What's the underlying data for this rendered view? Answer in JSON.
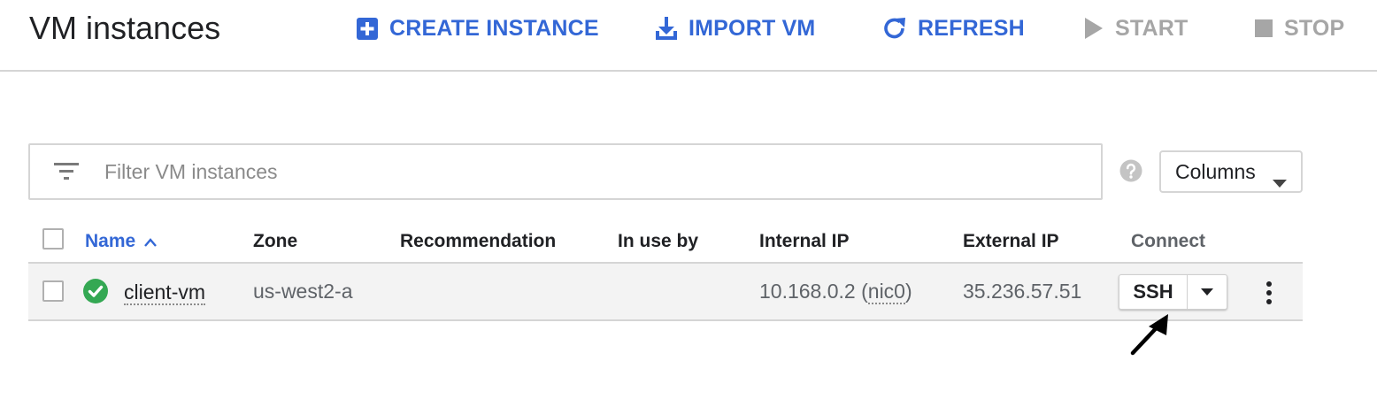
{
  "header": {
    "title": "VM instances",
    "actions": {
      "create": "CREATE INSTANCE",
      "import": "IMPORT VM",
      "refresh": "REFRESH",
      "start": "START",
      "stop": "STOP"
    }
  },
  "filter": {
    "placeholder": "Filter VM instances"
  },
  "columns_button": {
    "label": "Columns"
  },
  "table": {
    "headers": {
      "name": "Name",
      "zone": "Zone",
      "recommendation": "Recommendation",
      "in_use_by": "In use by",
      "internal_ip": "Internal IP",
      "external_ip": "External IP",
      "connect": "Connect"
    },
    "rows": [
      {
        "name": "client-vm",
        "zone": "us-west2-a",
        "recommendation": "",
        "in_use_by": "",
        "internal_ip_address": "10.168.0.2",
        "internal_ip_nic": "nic0",
        "external_ip": "35.236.57.51",
        "connect_label": "SSH",
        "status": "running"
      }
    ]
  },
  "colors": {
    "accent": "#3367d6",
    "disabled": "#a6a6a6",
    "status_ok": "#34a853",
    "row_bg": "#f3f3f3",
    "border": "#d5d5d5"
  },
  "icons": {
    "create": "add-box-icon",
    "import": "download-icon",
    "refresh": "refresh-icon",
    "start": "play-icon",
    "stop": "stop-icon",
    "filter": "filter-list-icon",
    "help": "help-icon",
    "status": "check-circle-icon",
    "more": "more-vert-icon"
  }
}
